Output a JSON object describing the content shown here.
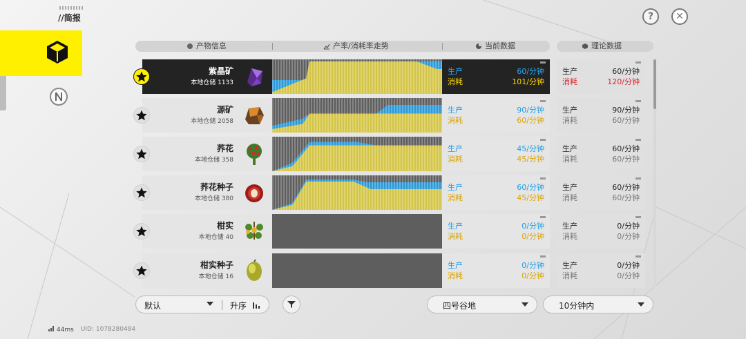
{
  "header": {
    "breadcrumb": "//简报",
    "help_icon": "?",
    "close_icon": "✕"
  },
  "columns": {
    "product": "产物信息",
    "trend": "产率/消耗率走势",
    "current": "当前数据",
    "theory": "理论数据"
  },
  "rows": [
    {
      "name": "紫晶矿",
      "stock": "本地仓储 1133",
      "active": true,
      "cur_prod_label": "生产",
      "cur_prod": "60/分钟",
      "cur_cons_label": "消耗",
      "cur_cons": "101/分钟",
      "th_prod_label": "生产",
      "th_prod": "60/分钟",
      "th_cons_label": "消耗",
      "th_cons": "120/分钟",
      "th_cons_warn": true
    },
    {
      "name": "源矿",
      "stock": "本地仓储 2058",
      "active": false,
      "cur_prod_label": "生产",
      "cur_prod": "90/分钟",
      "cur_cons_label": "消耗",
      "cur_cons": "60/分钟",
      "th_prod_label": "生产",
      "th_prod": "90/分钟",
      "th_cons_label": "消耗",
      "th_cons": "60/分钟",
      "th_cons_warn": false
    },
    {
      "name": "荞花",
      "stock": "本地仓储 358",
      "active": false,
      "cur_prod_label": "生产",
      "cur_prod": "45/分钟",
      "cur_cons_label": "消耗",
      "cur_cons": "45/分钟",
      "th_prod_label": "生产",
      "th_prod": "60/分钟",
      "th_cons_label": "消耗",
      "th_cons": "60/分钟",
      "th_cons_warn": false
    },
    {
      "name": "荞花种子",
      "stock": "本地仓储 380",
      "active": false,
      "cur_prod_label": "生产",
      "cur_prod": "60/分钟",
      "cur_cons_label": "消耗",
      "cur_cons": "45/分钟",
      "th_prod_label": "生产",
      "th_prod": "60/分钟",
      "th_cons_label": "消耗",
      "th_cons": "60/分钟",
      "th_cons_warn": false
    },
    {
      "name": "柑实",
      "stock": "本地仓储 40",
      "active": false,
      "cur_prod_label": "生产",
      "cur_prod": "0/分钟",
      "cur_cons_label": "消耗",
      "cur_cons": "0/分钟",
      "th_prod_label": "生产",
      "th_prod": "0/分钟",
      "th_cons_label": "消耗",
      "th_cons": "0/分钟",
      "th_cons_warn": false
    },
    {
      "name": "柑实种子",
      "stock": "本地仓储 16",
      "active": false,
      "cur_prod_label": "生产",
      "cur_prod": "0/分钟",
      "cur_cons_label": "消耗",
      "cur_cons": "0/分钟",
      "th_prod_label": "生产",
      "th_prod": "0/分钟",
      "th_cons_label": "消耗",
      "th_cons": "0/分钟",
      "th_cons_warn": false
    }
  ],
  "controls": {
    "sort_value": "默认",
    "order_label": "升序",
    "region_value": "四号谷地",
    "time_value": "10分钟内"
  },
  "footer": {
    "ping": "44ms",
    "uid": "UID: 1078280484"
  },
  "colors": {
    "accent": "#fff000",
    "production": "#1e9ee6",
    "consumption": "#d9a400",
    "warning": "#e0242b"
  }
}
